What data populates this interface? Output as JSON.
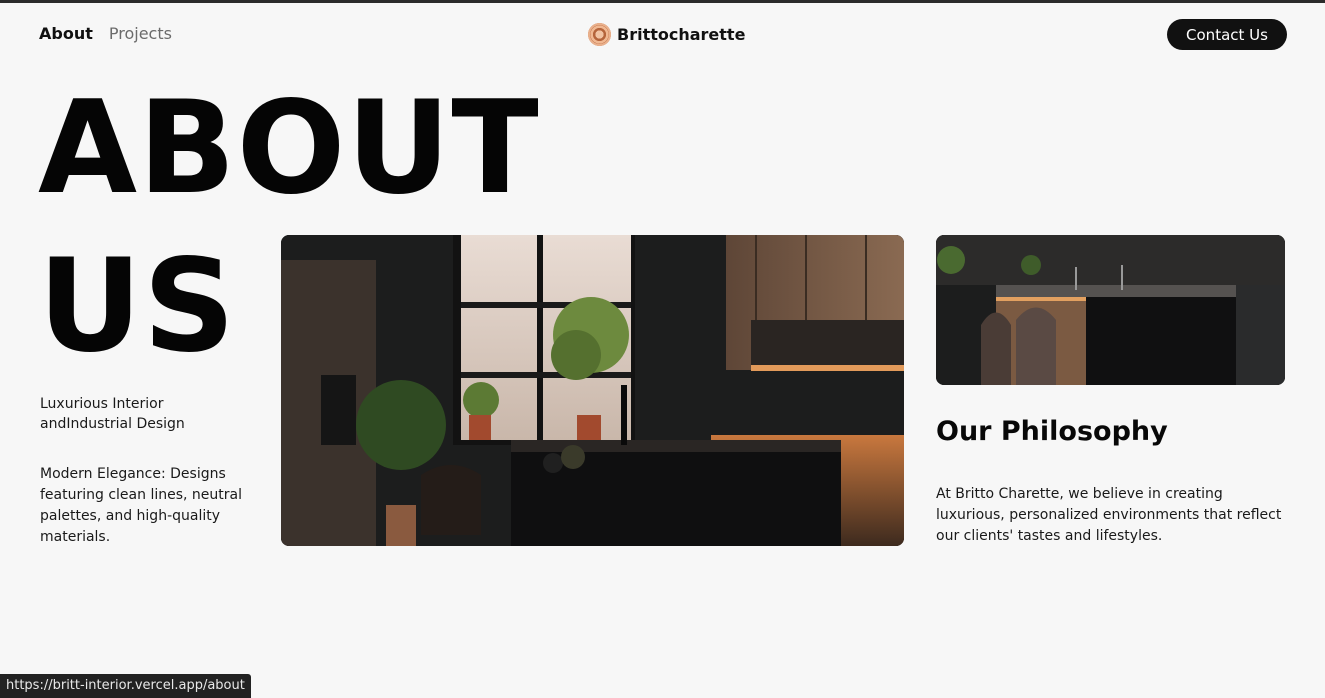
{
  "nav": {
    "about": "About",
    "projects": "Projects"
  },
  "brand": {
    "name": "Brittocharette"
  },
  "header": {
    "contact_label": "Contact Us"
  },
  "hero": {
    "line1": "ABOUT",
    "line2": "US"
  },
  "intro": {
    "tagline": "Luxurious Interior andIndustrial Design",
    "description": "Modern Elegance: Designs featuring clean lines, neutral palettes, and high-quality materials."
  },
  "philosophy": {
    "title": "Our Philosophy",
    "text": "At Britto Charette, we believe in creating luxurious, personalized environments that reflect our clients' tastes and lifestyles."
  },
  "status_bar": {
    "url": "https://britt-interior.vercel.app/about"
  },
  "colors": {
    "background": "#f7f7f7",
    "text": "#0d0d0d",
    "button": "#111111",
    "accent_copper": "#c8794f"
  }
}
